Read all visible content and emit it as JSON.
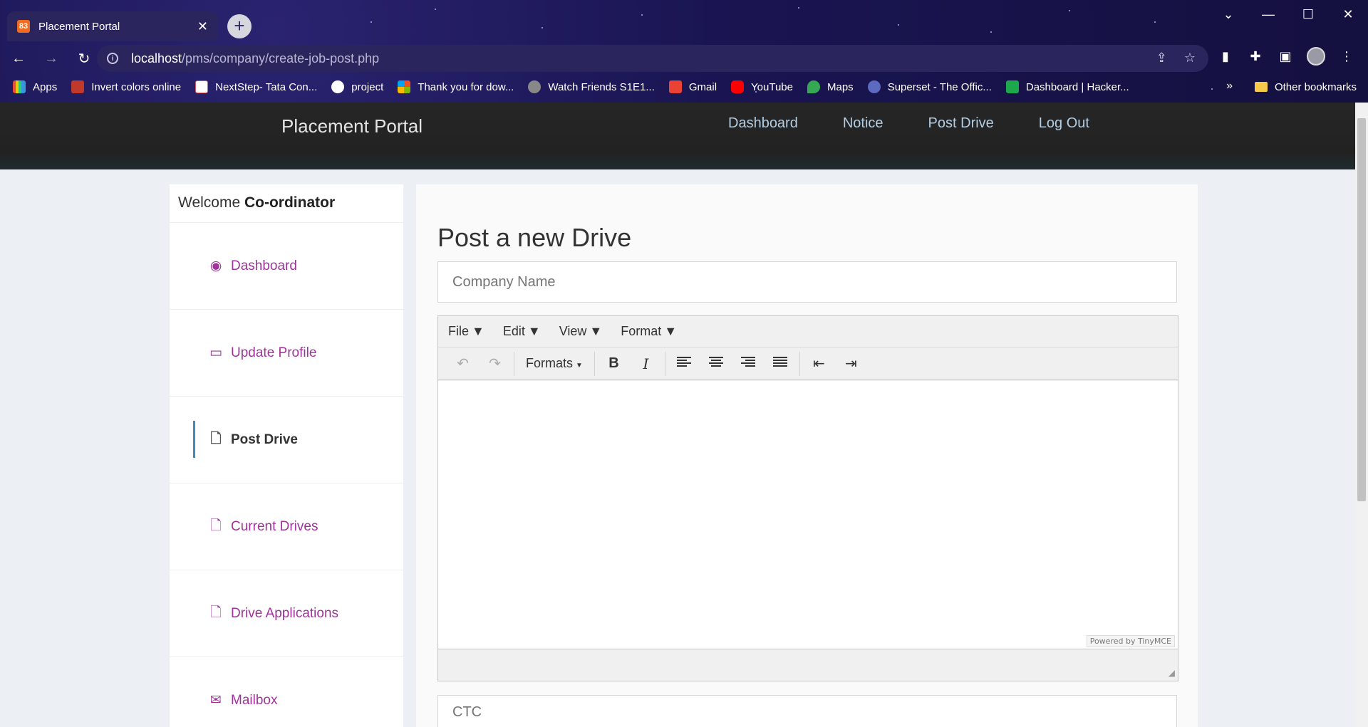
{
  "browser": {
    "tab_title": "Placement Portal",
    "tab_favicon_text": "83",
    "url_host": "localhost",
    "url_path": "/pms/company/create-job-post.php",
    "bookmarks": [
      {
        "label": "Apps",
        "color": "#e74c3c"
      },
      {
        "label": "Invert colors online",
        "color": "#c0392b"
      },
      {
        "label": "NextStep- Tata Con...",
        "color": "#e05a5a"
      },
      {
        "label": "project",
        "color": "#ffffff"
      },
      {
        "label": "Thank you for dow...",
        "color": "#2ecc71"
      },
      {
        "label": "Watch Friends S1E1...",
        "color": "#888888"
      },
      {
        "label": "Gmail",
        "color": "#ea4335"
      },
      {
        "label": "YouTube",
        "color": "#ff0000"
      },
      {
        "label": "Maps",
        "color": "#34a853"
      },
      {
        "label": "Superset - The Offic...",
        "color": "#5c6bc0"
      },
      {
        "label": "Dashboard | Hacker...",
        "color": "#2ecc71"
      }
    ],
    "more_bookmarks": "»",
    "other_bookmarks": "Other bookmarks"
  },
  "header": {
    "brand": "Placement Portal",
    "nav": [
      "Dashboard",
      "Notice",
      "Post Drive",
      "Log Out"
    ]
  },
  "sidebar": {
    "welcome_prefix": "Welcome ",
    "welcome_name": "Co-ordinator",
    "items": [
      {
        "label": "Dashboard",
        "icon": "dashboard-icon",
        "active": false
      },
      {
        "label": "Update Profile",
        "icon": "monitor-icon",
        "active": false
      },
      {
        "label": "Post Drive",
        "icon": "file-icon",
        "active": true
      },
      {
        "label": "Current Drives",
        "icon": "file-icon",
        "active": false
      },
      {
        "label": "Drive Applications",
        "icon": "file-icon",
        "active": false
      },
      {
        "label": "Mailbox",
        "icon": "envelope-icon",
        "active": false
      }
    ]
  },
  "main": {
    "title": "Post a new Drive",
    "company_placeholder": "Company Name",
    "ctc_placeholder": "CTC",
    "editor": {
      "menus": [
        "File",
        "Edit",
        "View",
        "Format"
      ],
      "formats_label": "Formats",
      "powered_by": "Powered by TinyMCE"
    }
  }
}
